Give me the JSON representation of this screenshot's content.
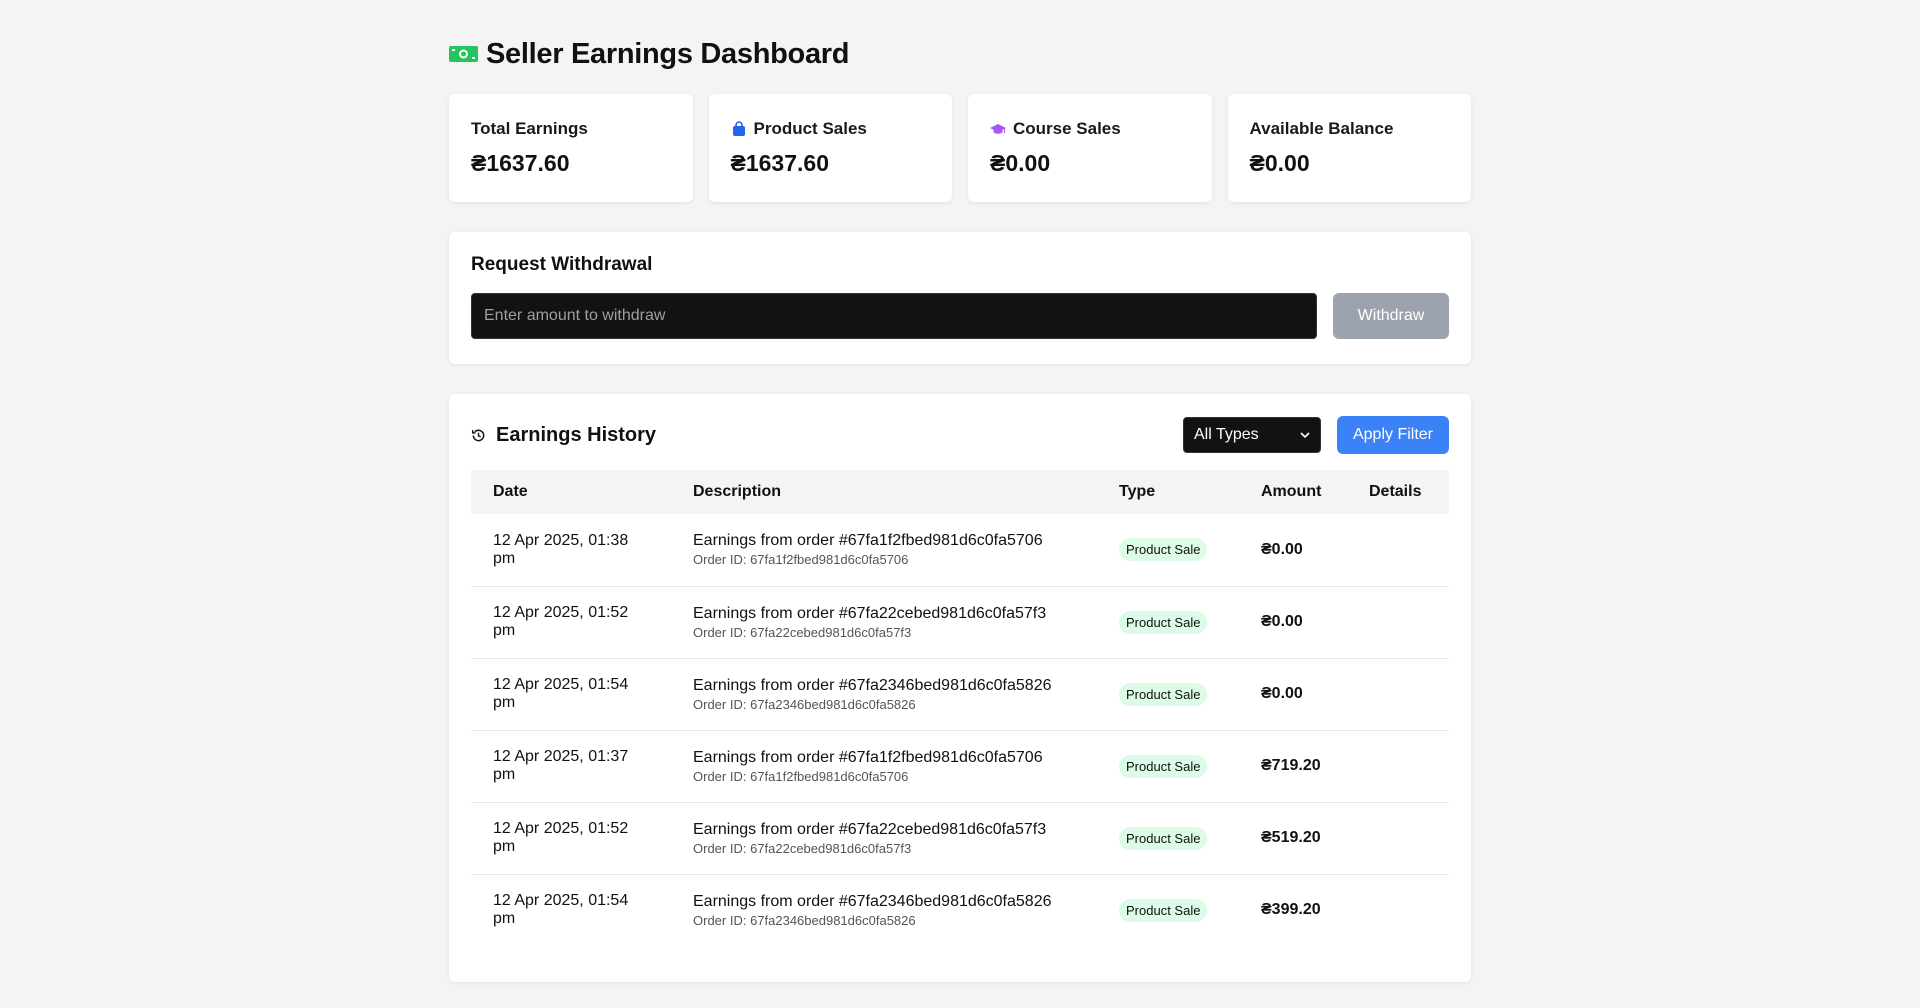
{
  "header": {
    "title": "Seller Earnings Dashboard",
    "icon": "money-icon"
  },
  "colors": {
    "accent": "#3b82f6",
    "money": "#22c55e",
    "product": "#2563eb",
    "course": "#a855f7",
    "badge_bg": "#dcfce7"
  },
  "cards": [
    {
      "label": "Total Earnings",
      "value": "₴1637.60",
      "icon": ""
    },
    {
      "label": "Product Sales",
      "value": "₴1637.60",
      "icon": "shopping-bag-icon"
    },
    {
      "label": "Course Sales",
      "value": "₴0.00",
      "icon": "graduation-cap-icon"
    },
    {
      "label": "Available Balance",
      "value": "₴0.00",
      "icon": ""
    }
  ],
  "withdrawal": {
    "title": "Request Withdrawal",
    "placeholder": "Enter amount to withdraw",
    "button": "Withdraw"
  },
  "history": {
    "title": "Earnings History",
    "filter_selected": "All Types",
    "apply_label": "Apply Filter",
    "columns": [
      "Date",
      "Description",
      "Type",
      "Amount",
      "Details"
    ],
    "rows": [
      {
        "date": "12 Apr 2025, 01:38 pm",
        "desc": "Earnings from order #67fa1f2fbed981d6c0fa5706",
        "order": "Order ID: 67fa1f2fbed981d6c0fa5706",
        "type": "Product Sale",
        "amount": "₴0.00",
        "details": ""
      },
      {
        "date": "12 Apr 2025, 01:52 pm",
        "desc": "Earnings from order #67fa22cebed981d6c0fa57f3",
        "order": "Order ID: 67fa22cebed981d6c0fa57f3",
        "type": "Product Sale",
        "amount": "₴0.00",
        "details": ""
      },
      {
        "date": "12 Apr 2025, 01:54 pm",
        "desc": "Earnings from order #67fa2346bed981d6c0fa5826",
        "order": "Order ID: 67fa2346bed981d6c0fa5826",
        "type": "Product Sale",
        "amount": "₴0.00",
        "details": ""
      },
      {
        "date": "12 Apr 2025, 01:37 pm",
        "desc": "Earnings from order #67fa1f2fbed981d6c0fa5706",
        "order": "Order ID: 67fa1f2fbed981d6c0fa5706",
        "type": "Product Sale",
        "amount": "₴719.20",
        "details": ""
      },
      {
        "date": "12 Apr 2025, 01:52 pm",
        "desc": "Earnings from order #67fa22cebed981d6c0fa57f3",
        "order": "Order ID: 67fa22cebed981d6c0fa57f3",
        "type": "Product Sale",
        "amount": "₴519.20",
        "details": ""
      },
      {
        "date": "12 Apr 2025, 01:54 pm",
        "desc": "Earnings from order #67fa2346bed981d6c0fa5826",
        "order": "Order ID: 67fa2346bed981d6c0fa5826",
        "type": "Product Sale",
        "amount": "₴399.20",
        "details": ""
      }
    ]
  }
}
